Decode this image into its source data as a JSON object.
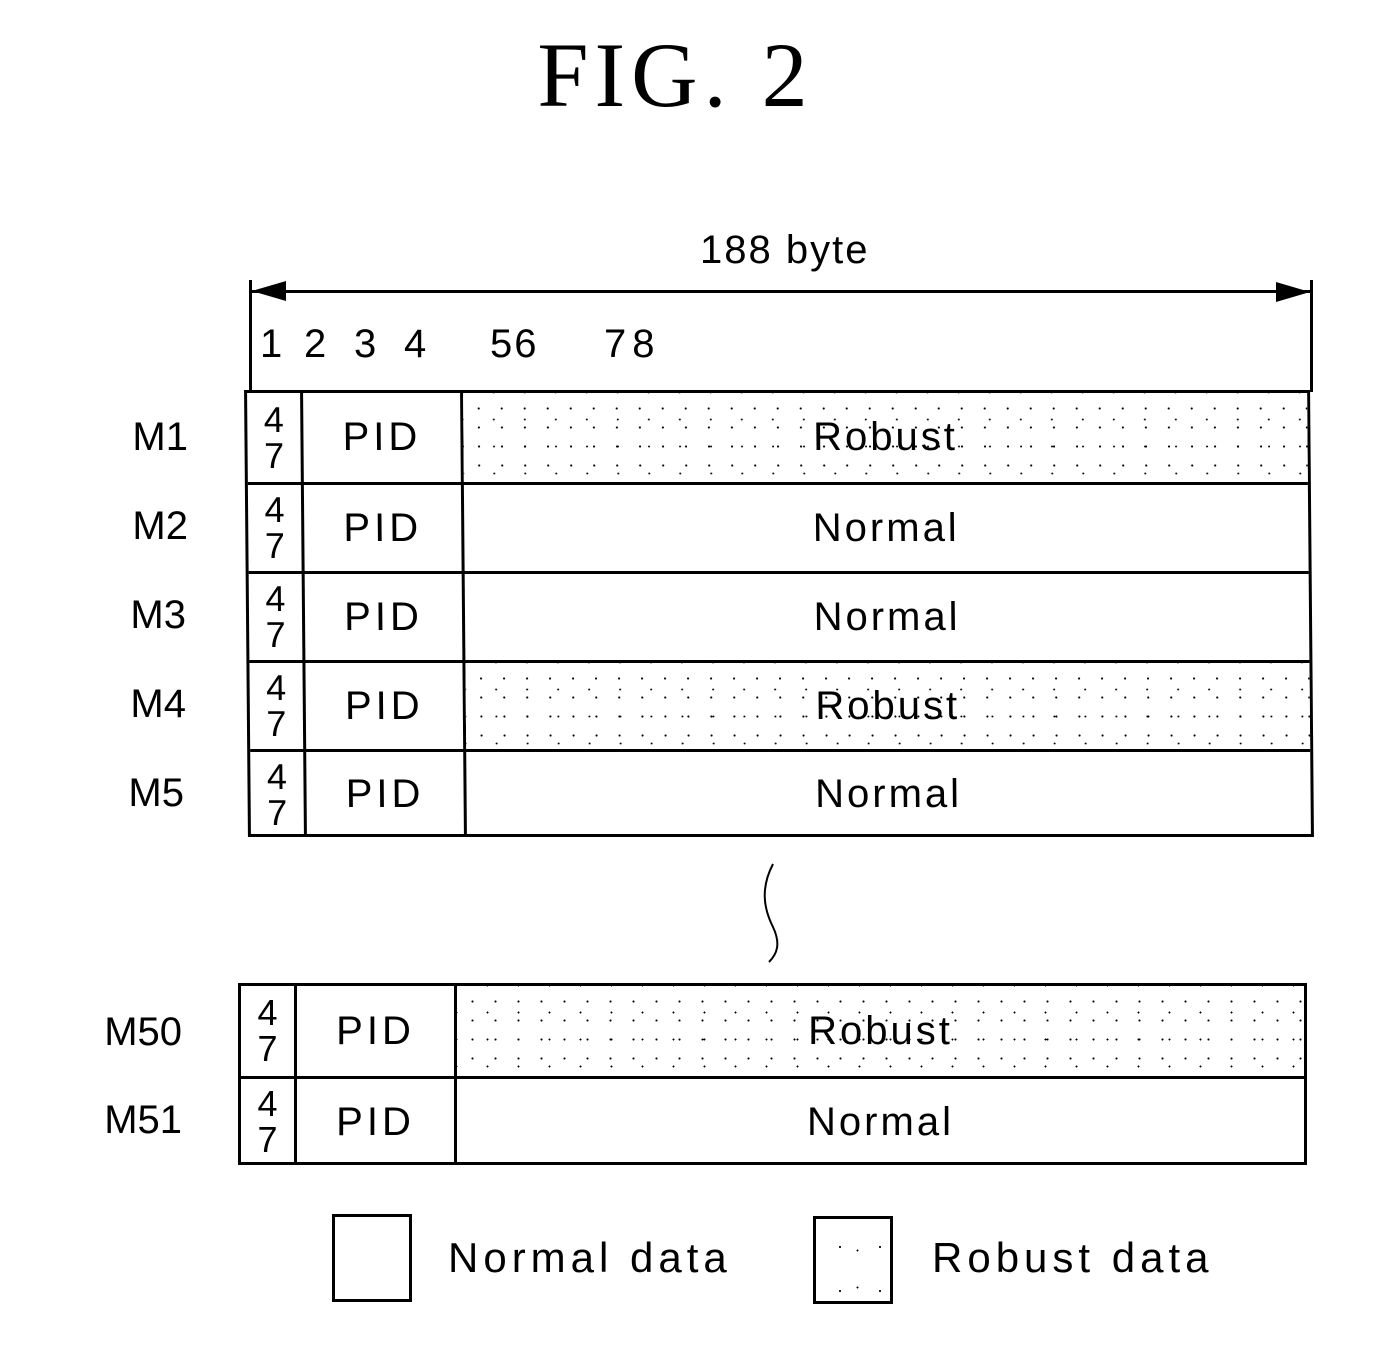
{
  "figure": {
    "title": "FIG. 2"
  },
  "dimension": {
    "label": "188 byte",
    "byte_numbers": [
      "1",
      "2",
      "3",
      "4",
      "56",
      "78"
    ]
  },
  "colors": {
    "line": "#000000",
    "background": "#ffffff",
    "robust_pattern": "#000000"
  },
  "rows_top": [
    {
      "label": "M1",
      "sync": [
        "4",
        "7"
      ],
      "pid": "PID",
      "payload": "Robust",
      "type": "robust"
    },
    {
      "label": "M2",
      "sync": [
        "4",
        "7"
      ],
      "pid": "PID",
      "payload": "Normal",
      "type": "normal"
    },
    {
      "label": "M3",
      "sync": [
        "4",
        "7"
      ],
      "pid": "PID",
      "payload": "Normal",
      "type": "normal"
    },
    {
      "label": "M4",
      "sync": [
        "4",
        "7"
      ],
      "pid": "PID",
      "payload": "Robust",
      "type": "robust"
    },
    {
      "label": "M5",
      "sync": [
        "4",
        "7"
      ],
      "pid": "PID",
      "payload": "Normal",
      "type": "normal"
    }
  ],
  "rows_bottom": [
    {
      "label": "M50",
      "sync": [
        "4",
        "7"
      ],
      "pid": "PID",
      "payload": "Robust",
      "type": "robust"
    },
    {
      "label": "M51",
      "sync": [
        "4",
        "7"
      ],
      "pid": "PID",
      "payload": "Normal",
      "type": "normal"
    }
  ],
  "legend": [
    {
      "label": "Normal data",
      "type": "normal"
    },
    {
      "label": "Robust data",
      "type": "robust"
    }
  ]
}
